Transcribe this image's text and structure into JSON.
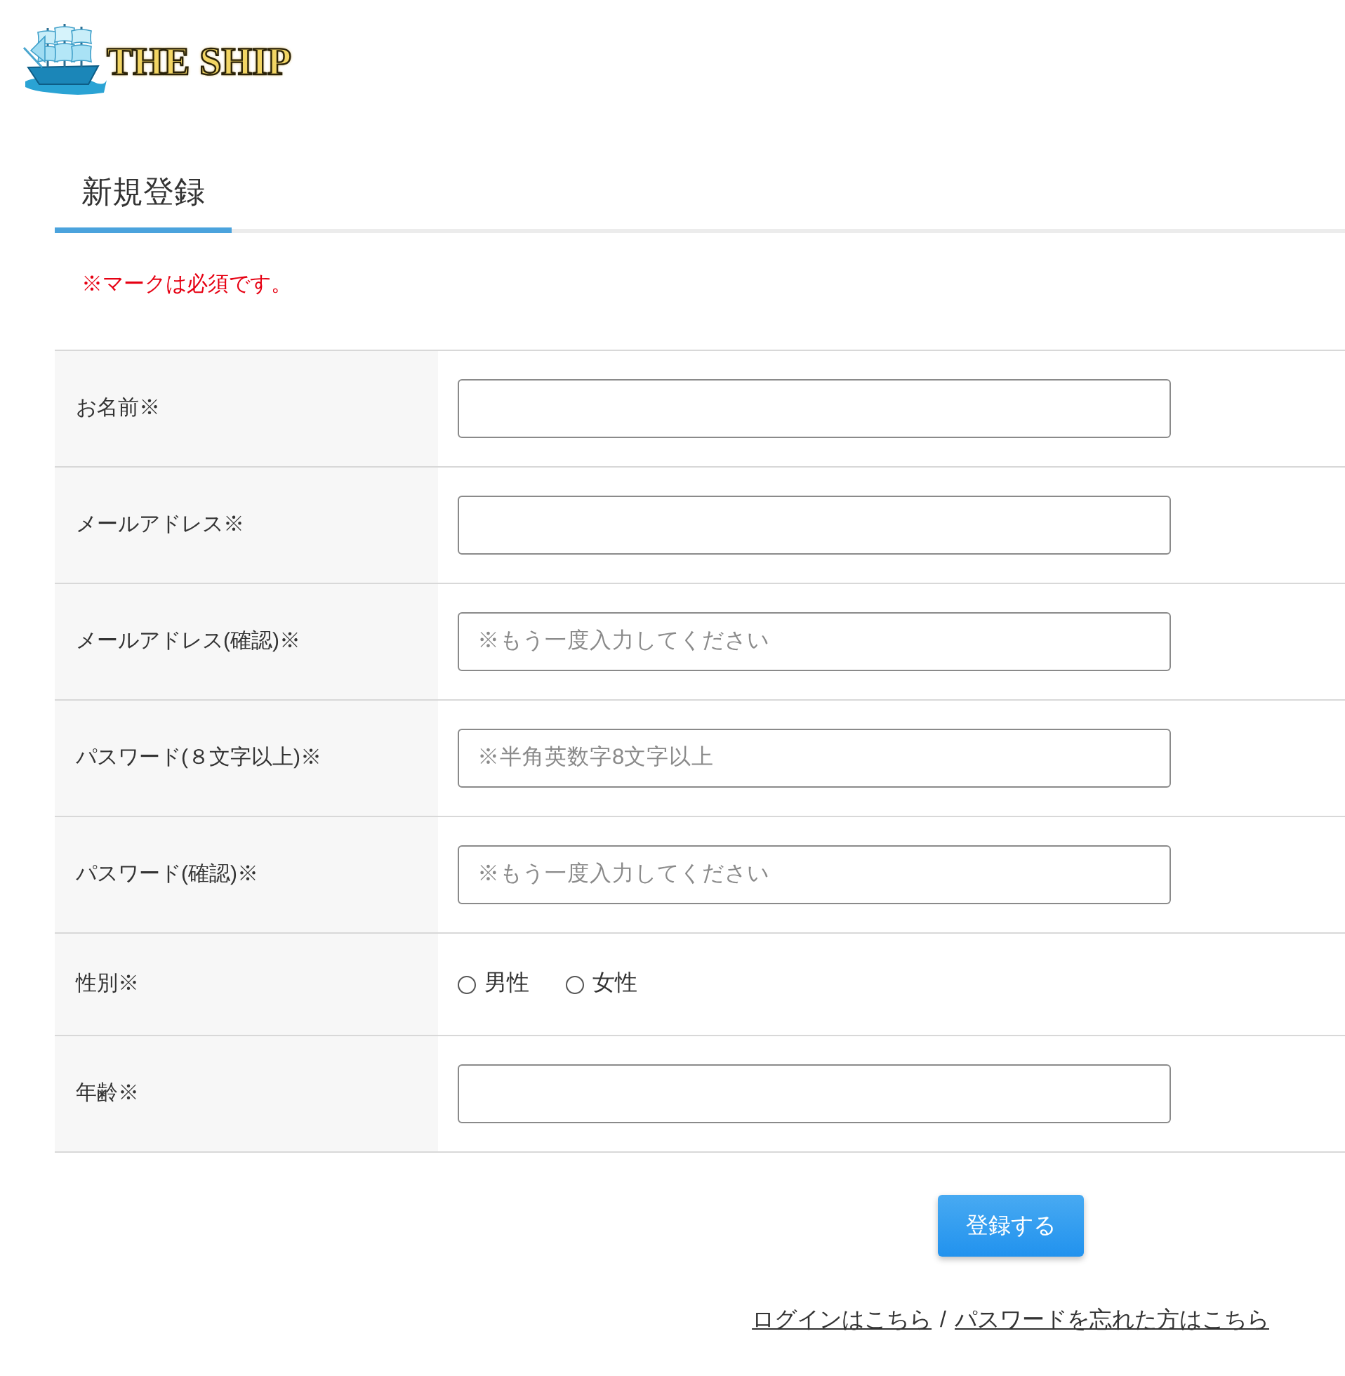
{
  "logo": {
    "text": "THE SHIP"
  },
  "page_title": "新規登録",
  "required_note": "※マークは必須です。",
  "form": {
    "rows": [
      {
        "label": "お名前※",
        "kind": "input"
      },
      {
        "label": "メールアドレス※",
        "kind": "input"
      },
      {
        "label": "メールアドレス(確認)※",
        "kind": "input",
        "placeholder": "※もう一度入力してください"
      },
      {
        "label": "パスワード(８文字以上)※",
        "kind": "input",
        "placeholder": "※半角英数字8文字以上"
      },
      {
        "label": "パスワード(確認)※",
        "kind": "input",
        "placeholder": "※もう一度入力してください"
      },
      {
        "label": "性別※",
        "kind": "radio",
        "options": [
          {
            "label": "男性",
            "selected": false
          },
          {
            "label": "女性",
            "selected": false
          }
        ]
      },
      {
        "label": "年齢※",
        "kind": "input"
      }
    ]
  },
  "submit_button": "登録する",
  "links": [
    {
      "label": "ログインはこちら"
    },
    {
      "label": "パスワードを忘れた方はこちら"
    }
  ],
  "link_separator": "/"
}
